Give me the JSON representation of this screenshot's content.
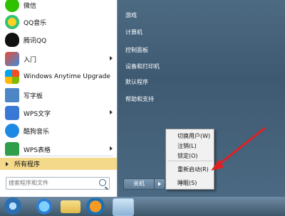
{
  "programs": [
    {
      "label": "微信",
      "icon": "wechat-icon",
      "color": "#2dc100",
      "arrow": false
    },
    {
      "label": "QQ音乐",
      "icon": "qq-music-icon",
      "color": "#31c27c",
      "arrow": false
    },
    {
      "label": "腾讯QQ",
      "icon": "qq-penguin-icon",
      "color": "#111111",
      "arrow": false
    },
    {
      "label": "入门",
      "icon": "getting-started-icon",
      "color": "#3b8ed8",
      "arrow": true
    },
    {
      "label": "Windows Anytime Upgrade",
      "icon": "windows-logo-icon",
      "color": "#e8a33a",
      "arrow": false
    },
    {
      "label": "写字板",
      "icon": "wordpad-icon",
      "color": "#4d86c4",
      "arrow": false
    },
    {
      "label": "WPS文字",
      "icon": "wps-writer-icon",
      "color": "#3a78d6",
      "arrow": true
    },
    {
      "label": "酷狗音乐",
      "icon": "kugou-icon",
      "color": "#1e88e5",
      "arrow": false
    },
    {
      "label": "WPS表格",
      "icon": "wps-spreadsheet-icon",
      "color": "#2e9e4a",
      "arrow": true
    }
  ],
  "all_programs": "所有程序",
  "search": {
    "placeholder": "搜索程序和文件"
  },
  "right_links": [
    "游戏",
    "计算机",
    "控制面板",
    "设备和打印机",
    "默认程序",
    "帮助和支持"
  ],
  "shutdown": {
    "label": "关机"
  },
  "power_menu": [
    "切换用户(W)",
    "注销(L)",
    "锁定(O)",
    "重新启动(R)",
    "睡眠(S)"
  ],
  "taskbar": [
    "start-orb-icon",
    "ie-icon",
    "explorer-icon",
    "media-player-icon",
    "app-icon"
  ],
  "colors": {
    "highlight": "#f5d98a",
    "annotation_arrow": "#e02020"
  }
}
